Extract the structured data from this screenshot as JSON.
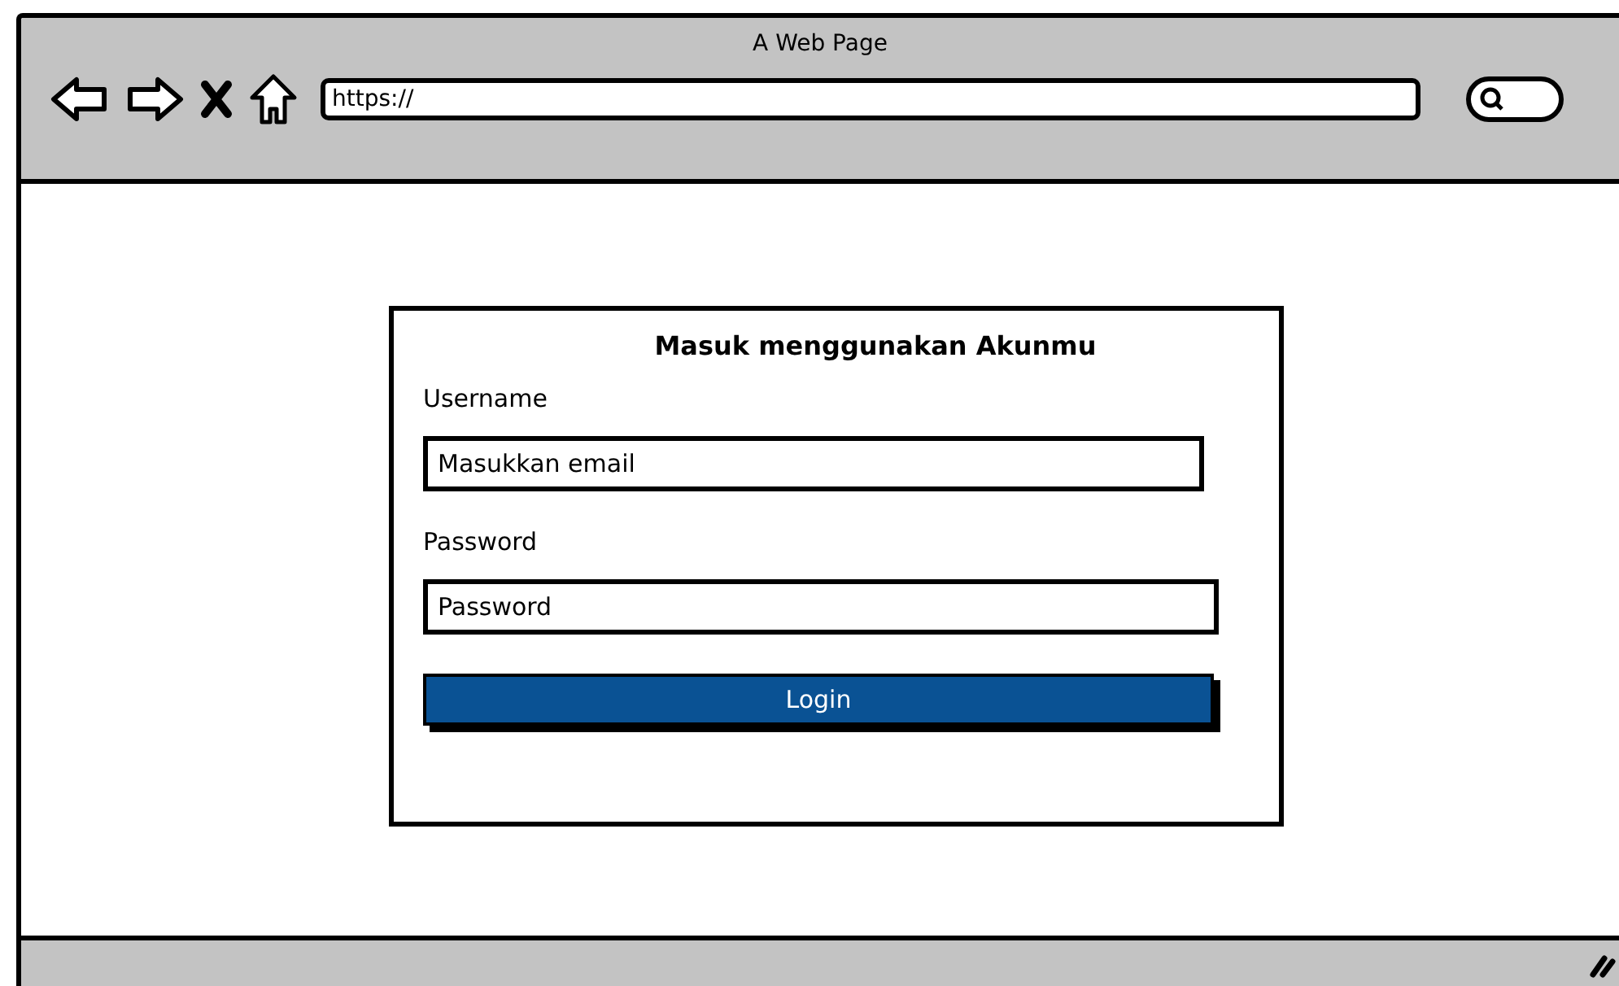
{
  "window": {
    "title": "A Web Page"
  },
  "address_bar": {
    "value": "https://"
  },
  "login_card": {
    "title": "Masuk menggunakan Akunmu",
    "fields": [
      {
        "label": "Username",
        "placeholder": "Masukkan email"
      },
      {
        "label": "Password",
        "placeholder": "Password"
      }
    ],
    "button": "Login"
  }
}
